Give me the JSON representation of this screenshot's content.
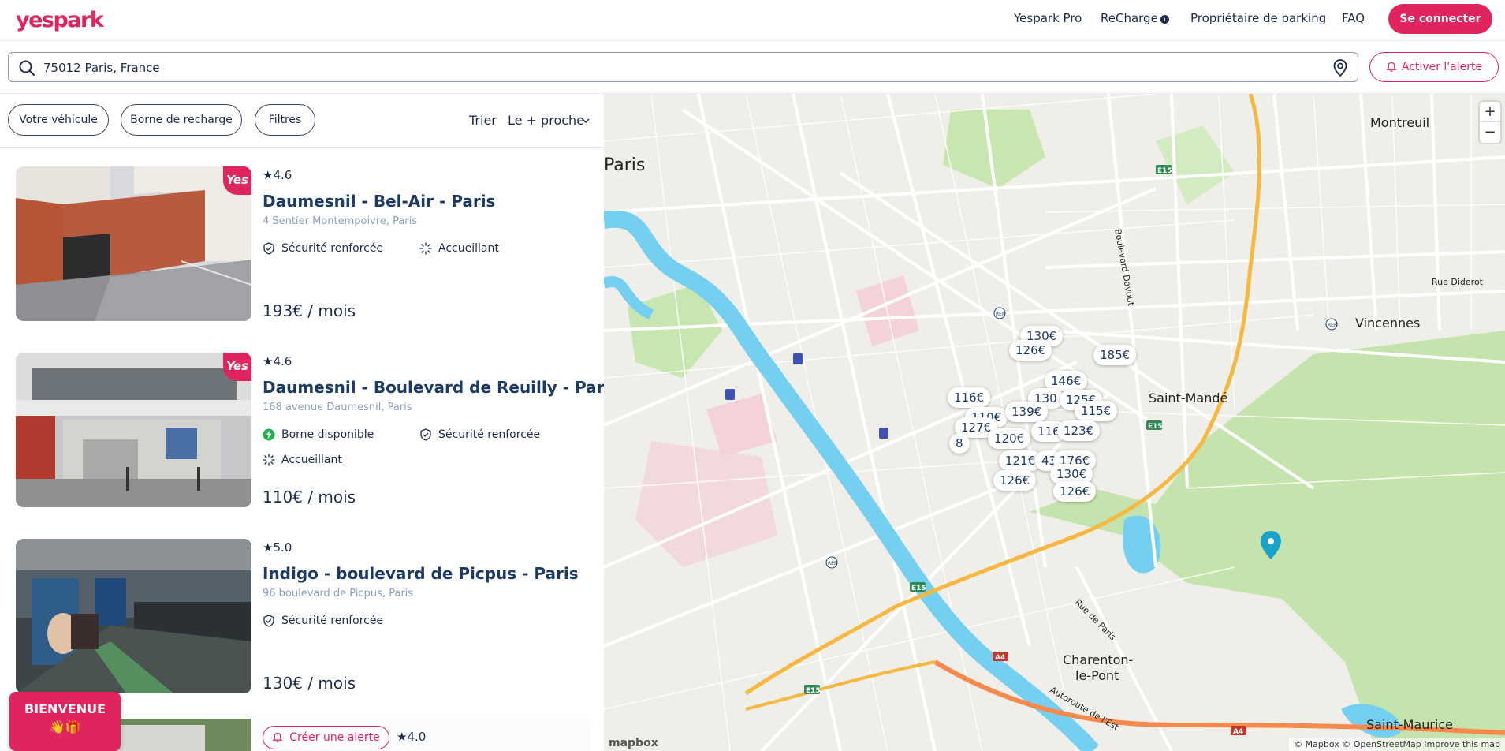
{
  "header": {
    "logo": "yespark",
    "nav": [
      "Yespark Pro",
      "ReCharge",
      "Propriétaire de parking",
      "FAQ"
    ],
    "recharge_info": "i",
    "login": "Se connecter"
  },
  "search": {
    "value": "75012 Paris, France",
    "alert_button": "Activer l'alerte"
  },
  "filters": {
    "vehicle": "Votre véhicule",
    "charger": "Borne de recharge",
    "filters": "Filtres",
    "sort_label": "Trier",
    "sort_value": "Le + proche"
  },
  "listings": [
    {
      "rating": "4.6",
      "title": "Daumesnil - Bel-Air - Paris",
      "address": "4 Sentier Montempoivre, Paris",
      "features": [
        "Sécurité renforcée",
        "Accueillant"
      ],
      "price": "193€ / mois",
      "badge": "Yes"
    },
    {
      "rating": "4.6",
      "title": "Daumesnil - Boulevard de Reuilly - Paris",
      "address": "168 avenue Daumesnil, Paris",
      "features": [
        "Borne disponible",
        "Sécurité renforcée",
        "Accueillant"
      ],
      "price": "110€ / mois",
      "badge": "Yes"
    },
    {
      "rating": "5.0",
      "title": "Indigo - boulevard de Picpus - Paris",
      "address": "96 boulevard de Picpus, Paris",
      "features": [
        "Sécurité renforcée"
      ],
      "price": "130€ / mois"
    },
    {
      "rating": "4.0",
      "alert_chip": "Créer une alerte"
    }
  ],
  "welcome": {
    "line1": "BIENVENUE",
    "line2": "👋🎁"
  },
  "map": {
    "places": [
      "Paris",
      "Montreuil",
      "Vincennes",
      "Saint-Mandé",
      "Charenton-",
      "le-Pont",
      "Saint-Maurice",
      "Rue Diderot",
      "Boulevard Davout",
      "Rue de Paris",
      "Autoroute de l'Est"
    ],
    "road_badges": [
      "E15",
      "E15",
      "E15",
      "E15",
      "A4",
      "A4"
    ],
    "rer": [
      "RER",
      "RER",
      "RER"
    ],
    "markers": [
      "130€",
      "126€",
      "185€",
      "146€",
      "116€",
      "130",
      "125€",
      "110€",
      "139€",
      "115€",
      "127€",
      "116",
      "123€",
      "8",
      "120€",
      "121€",
      "43",
      "176€",
      "126€",
      "130€",
      "126€",
      "139€",
      "120€"
    ],
    "zoom_in": "+",
    "zoom_out": "−",
    "logo": "mapbox",
    "attribution": "© Mapbox © OpenStreetMap Improve this map"
  },
  "colors": {
    "brand": "#e0245e",
    "text": "#1c2b4a",
    "water": "#75cff0",
    "park": "#c8e6b0",
    "highway": "#f5b942"
  }
}
